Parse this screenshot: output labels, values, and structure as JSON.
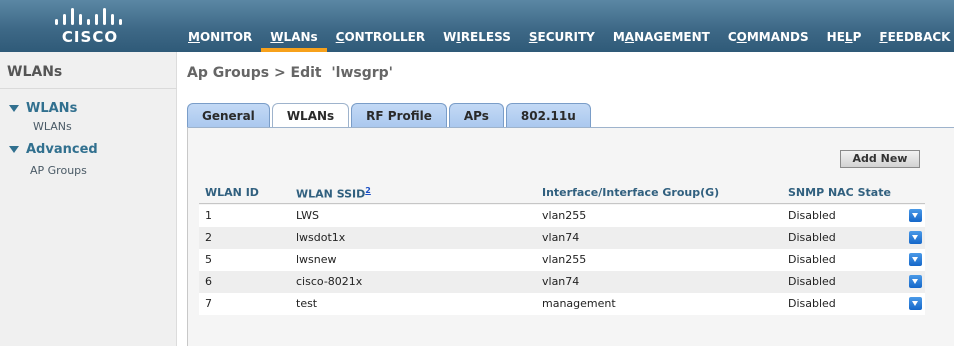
{
  "brand": {
    "logo_text": "CISCO"
  },
  "nav": {
    "items": [
      {
        "pre": "",
        "ul": "M",
        "post": "ONITOR"
      },
      {
        "pre": "",
        "ul": "W",
        "post": "LANs"
      },
      {
        "pre": "",
        "ul": "C",
        "post": "ONTROLLER"
      },
      {
        "pre": "W",
        "ul": "I",
        "post": "RELESS"
      },
      {
        "pre": "",
        "ul": "S",
        "post": "ECURITY"
      },
      {
        "pre": "M",
        "ul": "A",
        "post": "NAGEMENT"
      },
      {
        "pre": "C",
        "ul": "O",
        "post": "MMANDS"
      },
      {
        "pre": "HE",
        "ul": "L",
        "post": "P"
      },
      {
        "pre": "",
        "ul": "F",
        "post": "EEDBACK"
      }
    ],
    "active_index": 1
  },
  "sidebar": {
    "title": "WLANs",
    "sections": [
      {
        "label": "WLANs",
        "sub": "WLANs"
      },
      {
        "label": "Advanced",
        "sub": "AP Groups"
      }
    ]
  },
  "page": {
    "title": "Ap Groups > Edit  'lwsgrp'"
  },
  "tabs": [
    "General",
    "WLANs",
    "RF Profile",
    "APs",
    "802.11u"
  ],
  "active_tab": 1,
  "panel": {
    "add_new_label": "Add New"
  },
  "table": {
    "columns": [
      "WLAN ID",
      "WLAN SSID",
      "Interface/Interface Group(G)",
      "SNMP NAC State"
    ],
    "ssid_footnote": "2",
    "rows": [
      {
        "id": "1",
        "ssid": "LWS",
        "iface": "vlan255",
        "nac": "Disabled"
      },
      {
        "id": "2",
        "ssid": "lwsdot1x",
        "iface": "vlan74",
        "nac": "Disabled"
      },
      {
        "id": "5",
        "ssid": "lwsnew",
        "iface": "vlan255",
        "nac": "Disabled"
      },
      {
        "id": "6",
        "ssid": "cisco-8021x",
        "iface": "vlan74",
        "nac": "Disabled"
      },
      {
        "id": "7",
        "ssid": "test",
        "iface": "management",
        "nac": "Disabled"
      }
    ]
  },
  "colors": {
    "accent_orange": "#f7a11b",
    "header_blue": "#3e6987",
    "link_blue": "#31708f"
  }
}
